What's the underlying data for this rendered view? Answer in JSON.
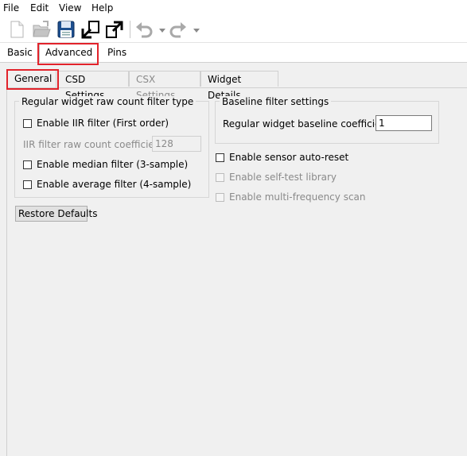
{
  "menu": {
    "file": "File",
    "edit": "Edit",
    "view": "View",
    "help": "Help"
  },
  "toolbar": {
    "icons": [
      "new-file-icon",
      "open-folder-icon",
      "save-icon",
      "import-icon",
      "export-icon",
      "undo-icon",
      "redo-icon"
    ]
  },
  "top_tabs": {
    "basic": "Basic",
    "advanced": "Advanced",
    "pins": "Pins",
    "selected": "Advanced"
  },
  "inner_tabs": {
    "general": "General",
    "csd": "CSD Settings",
    "csx": "CSX Settings",
    "widget_details": "Widget Details",
    "selected": "General"
  },
  "filter_group": {
    "title": "Regular widget raw count filter type",
    "iir": "Enable IIR filter (First order)",
    "iir_coeff_label": "IIR filter raw count coefficient:",
    "iir_coeff_value": "128",
    "median": "Enable median filter (3-sample)",
    "average": "Enable average filter (4-sample)"
  },
  "baseline_group": {
    "title": "Baseline filter settings",
    "coeff_label": "Regular widget baseline coefficient:",
    "coeff_value": "1"
  },
  "options": {
    "auto_reset": "Enable sensor auto-reset",
    "self_test": "Enable self-test library",
    "multi_freq": "Enable multi-frequency scan"
  },
  "restore_defaults": "Restore Defaults",
  "colors": {
    "highlight": "#e2232b",
    "background": "#f0f0f0"
  }
}
